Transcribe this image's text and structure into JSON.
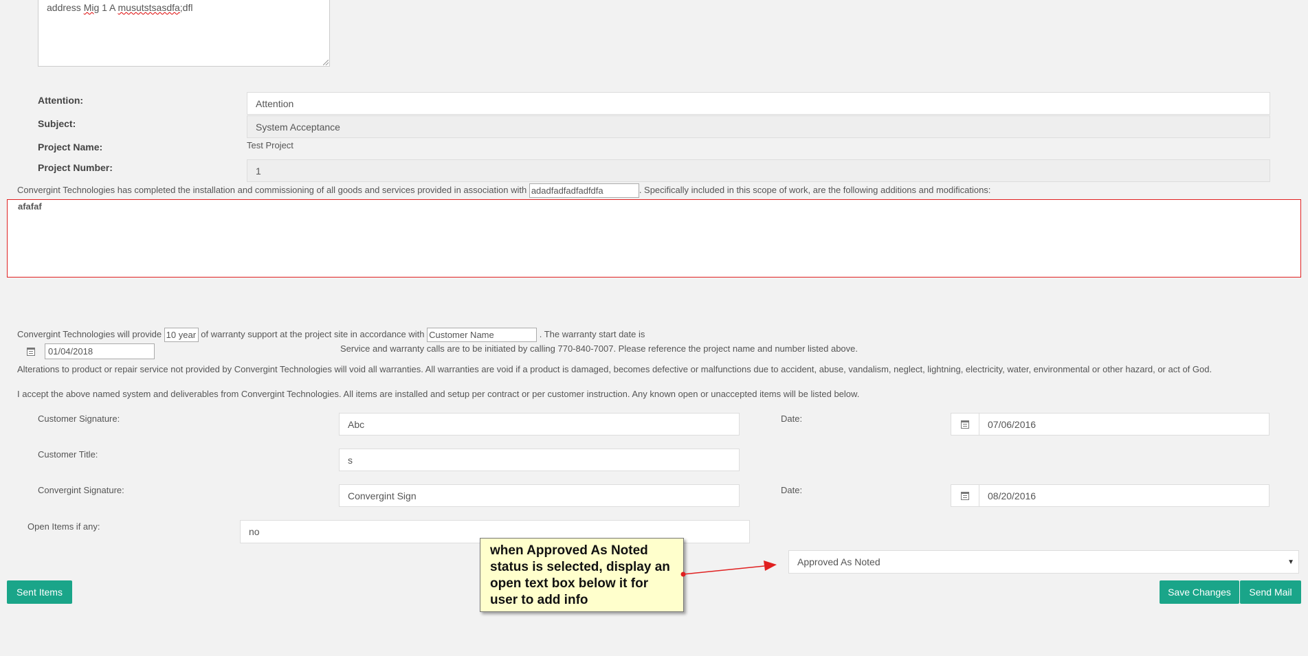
{
  "address_box": {
    "prefix": "address ",
    "w1": "Mig",
    "mid": " 1 A ",
    "w2": "musutstsasdfa",
    "suffix": ";dfl"
  },
  "fields": {
    "attention_label": "Attention:",
    "attention_value": "Attention",
    "subject_label": "Subject:",
    "subject_value": "System Acceptance",
    "project_name_label": "Project Name:",
    "project_name_value": "Test Project",
    "project_number_label": "Project Number:",
    "project_number_value": "1"
  },
  "scope": {
    "text_before": "Convergint Technologies has completed the installation and commissioning of all goods and services provided in association with",
    "association_value": "adadfadfadfadfdfa",
    "text_after": ". Specifically included in this scope of work, are the following additions and modifications:",
    "editor_content": "afafaf"
  },
  "warranty": {
    "text1": "Convergint Technologies will provide",
    "years_value": "10 year",
    "text2": "of warranty support at the project site in accordance with",
    "customer_placeholder": "Customer Name",
    "text3": ". The warranty start date is",
    "start_date": "01/04/2018",
    "calls_text": "Service and warranty calls are to be initiated by calling 770-840-7007. Please reference the project name and number listed above.",
    "alterations_text": "Alterations to product or repair service not provided by Convergint Technologies will void all warranties. All warranties are void if a product is damaged, becomes defective or malfunctions due to accident, abuse, vandalism, neglect, lightning, electricity, water, environmental or other hazard, or act of God.",
    "accept_text": "I accept the above named system and deliverables from Convergint Technologies. All items are installed and setup per contract or per customer instruction. Any known open or unaccepted items will be listed below."
  },
  "signatures": {
    "customer_signature_label": "Customer Signature:",
    "customer_signature_value": "Abc",
    "date1_label": "Date:",
    "date1_value": "07/06/2016",
    "customer_title_label": "Customer Title:",
    "customer_title_value": "s",
    "convergint_signature_label": "Convergint Signature:",
    "convergint_signature_value": "Convergint Sign",
    "date2_label": "Date:",
    "date2_value": "08/20/2016",
    "open_items_label": "Open Items if any:",
    "open_items_value": "no"
  },
  "status_select": {
    "value": "Approved As Noted"
  },
  "buttons": {
    "sent_items": "Sent Items",
    "save_changes": "Save Changes",
    "send_mail": "Send Mail"
  },
  "annotation": {
    "text": "when Approved As Noted status is selected, display an open text box below it for user to add info",
    "arrow_color": "#e02020"
  },
  "colors": {
    "accent": "#1aa589",
    "editor_border": "#e02020",
    "background": "#f2f2f2"
  },
  "icons": {
    "date_picker": "calendar-icon",
    "select": "caret-down-icon"
  }
}
